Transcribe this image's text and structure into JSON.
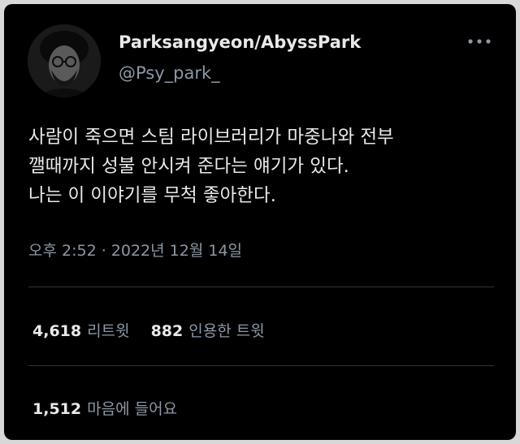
{
  "user": {
    "display_name": "Parksangyeon/AbyssPark",
    "handle": "@Psy_park_",
    "avatar_icon": "profile-photo-avatar"
  },
  "tweet": {
    "lines": [
      "사람이 죽으면 스팀 라이브러리가 마중나와 전부",
      "깰때까지 성불 안시켜 준다는 얘기가 있다.",
      "나는 이 이야기를 무척 좋아한다."
    ],
    "timestamp": "오후 2:52 · 2022년 12월 14일"
  },
  "stats": {
    "retweets": {
      "count": "4,618",
      "label": "리트윗"
    },
    "quotes": {
      "count": "882",
      "label": "인용한 트윗"
    },
    "likes": {
      "count": "1,512",
      "label": "마음에 들어요"
    }
  },
  "icons": {
    "more": "more-horizontal-icon"
  },
  "colors": {
    "background": "#000000",
    "primary_text": "#e7e9ea",
    "secondary_text": "#8b98a5",
    "divider": "#2f3336"
  }
}
